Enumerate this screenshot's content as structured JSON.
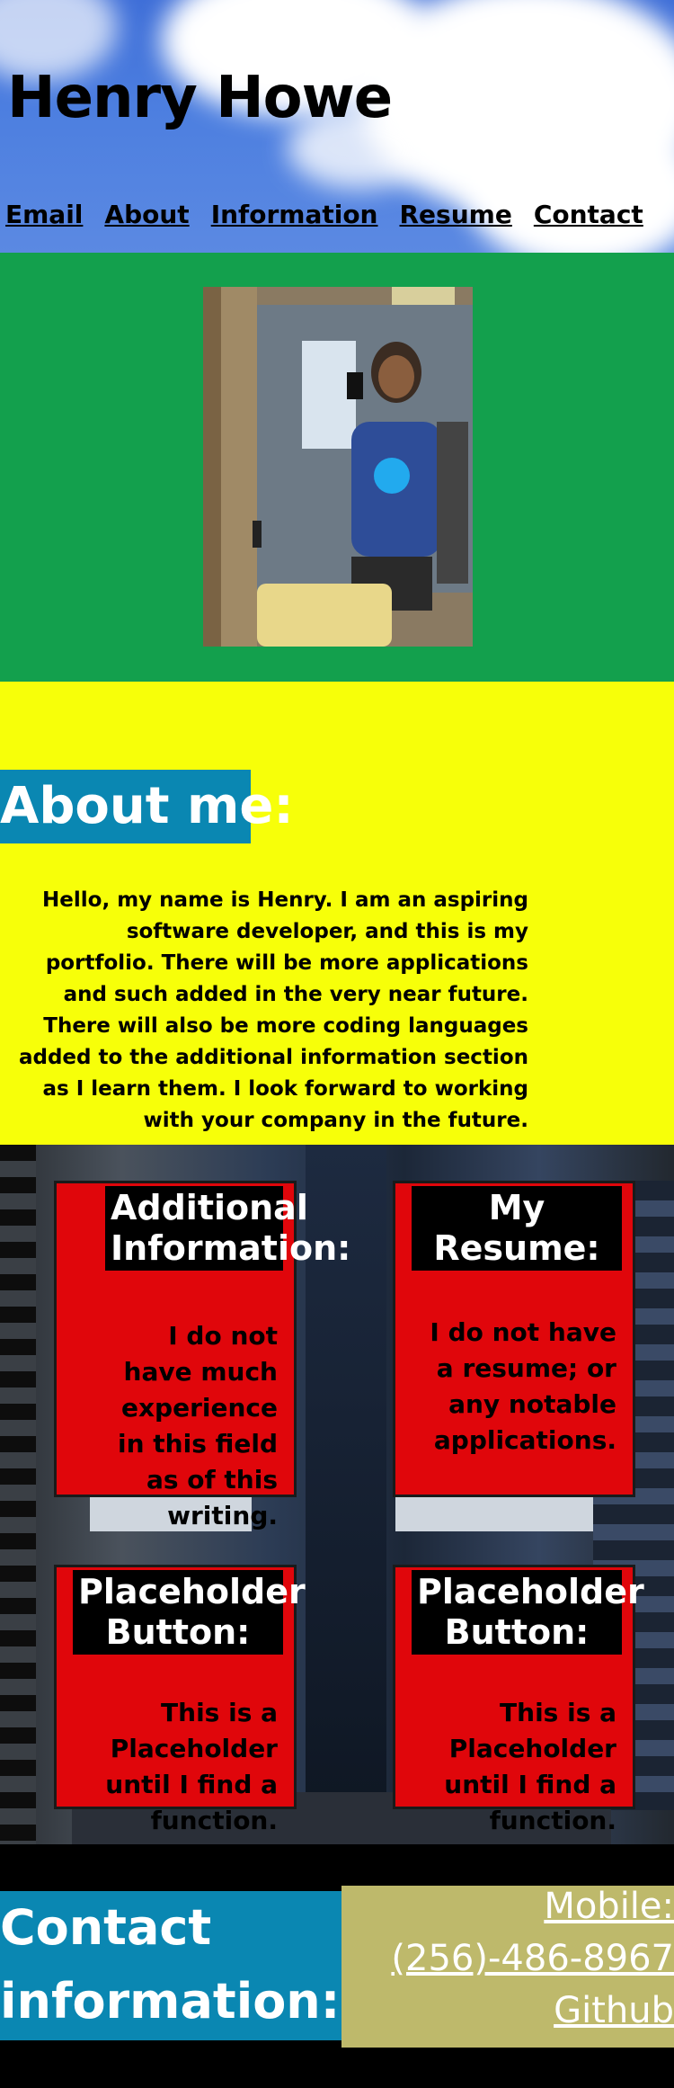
{
  "header": {
    "title": "Henry Howe",
    "nav": [
      "Email",
      "About",
      "Information",
      "Resume",
      "Contact"
    ]
  },
  "about": {
    "heading": "About me:",
    "text": "Hello, my name is Henry. I am an aspiring software developer, and this is my portfolio. There will be more applications and such added in the very near future. There will also be more coding languages added to the additional information section as I learn them. I look forward to working with your company in the future."
  },
  "cards": [
    {
      "title": "Additional Information:",
      "text": "I do not have much experience in this field as of this writing."
    },
    {
      "title": "My Resume:",
      "text": "I do not have a resume; or any notable applications."
    },
    {
      "title": "Placeholder Button:",
      "text": "This is a Placeholder until I find a function."
    },
    {
      "title": "Placeholder Button:",
      "text": "This is a Placeholder until I find a function."
    }
  ],
  "contact": {
    "heading": "Contact information:",
    "mobile_label": "Mobile:",
    "phone": "(256)-486-8967",
    "github": "Github"
  },
  "colors": {
    "header_blue": "#4d7fe0",
    "photo_green": "#13a04d",
    "about_yellow": "#f7ff09",
    "heading_teal": "#0a87b2",
    "card_red": "#e0060b",
    "contact_khaki": "#beb96b"
  }
}
